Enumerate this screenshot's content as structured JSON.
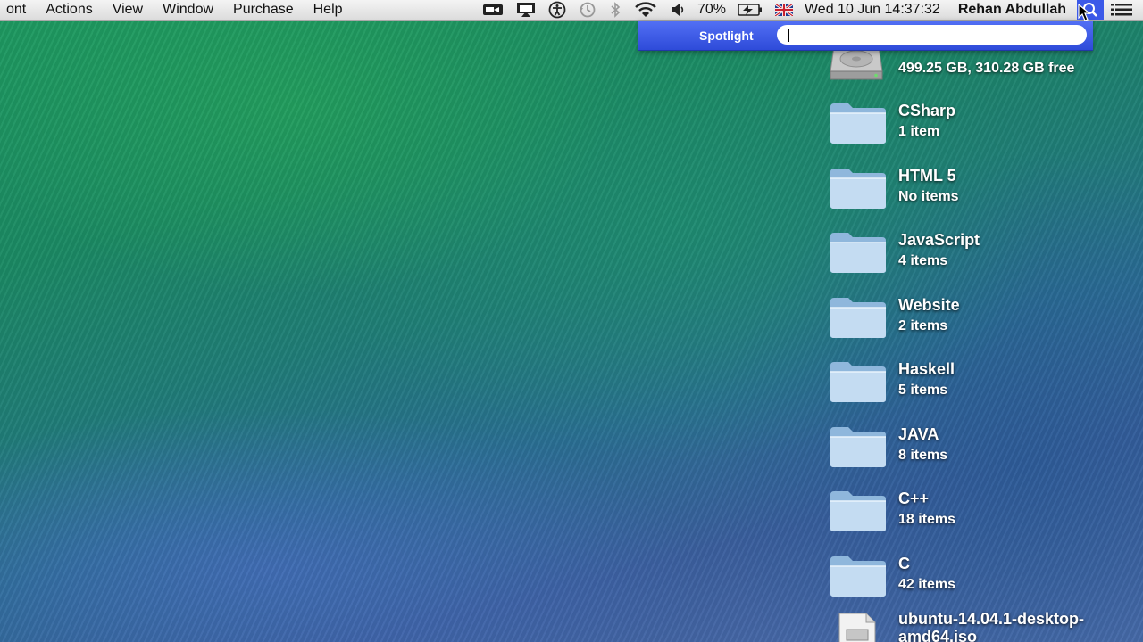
{
  "menubar": {
    "menus": [
      "ont",
      "Actions",
      "View",
      "Window",
      "Purchase",
      "Help"
    ],
    "battery": "70%",
    "datetime": "Wed 10 Jun  14:37:32",
    "user": "Rehan Abdullah",
    "status_icons": [
      "facetime-camera-icon",
      "airplay-icon",
      "accessibility-icon",
      "time-machine-icon",
      "bluetooth-icon",
      "wifi-icon",
      "volume-icon",
      "battery-icon",
      "uk-flag-icon"
    ]
  },
  "spotlight": {
    "label": "Spotlight",
    "query": "",
    "accent": "#3b59e8"
  },
  "desktop": {
    "drive": {
      "detail": "499.25 GB, 310.28 GB free"
    },
    "folders": [
      {
        "name": "CSharp",
        "detail": "1 item"
      },
      {
        "name": "HTML 5",
        "detail": "No items"
      },
      {
        "name": "JavaScript",
        "detail": "4 items"
      },
      {
        "name": "Website",
        "detail": "2 items"
      },
      {
        "name": "Haskell",
        "detail": "5 items"
      },
      {
        "name": "JAVA",
        "detail": "8 items"
      },
      {
        "name": "C++",
        "detail": "18 items"
      },
      {
        "name": "C",
        "detail": "42 items"
      }
    ],
    "disk_image": {
      "name_line1": "ubuntu-14.04.1-desktop-",
      "name_line2": "amd64.iso"
    }
  }
}
